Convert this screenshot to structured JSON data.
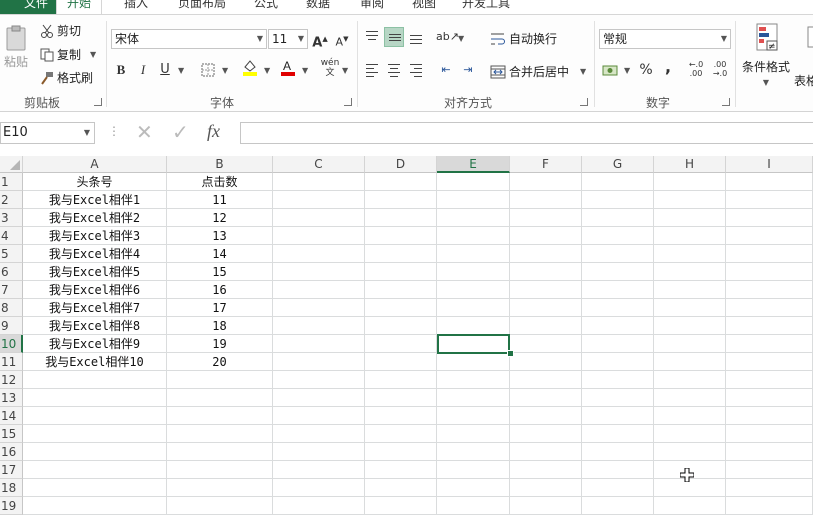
{
  "tabs": [
    {
      "label": "文件",
      "name": "tab-file"
    },
    {
      "label": "开始",
      "name": "tab-home"
    },
    {
      "label": "插入",
      "name": "tab-insert"
    },
    {
      "label": "页面布局",
      "name": "tab-page-layout"
    },
    {
      "label": "公式",
      "name": "tab-formulas"
    },
    {
      "label": "数据",
      "name": "tab-data"
    },
    {
      "label": "审阅",
      "name": "tab-review"
    },
    {
      "label": "视图",
      "name": "tab-view"
    },
    {
      "label": "开发工具",
      "name": "tab-developer"
    }
  ],
  "active_tab": "开始",
  "clipboard": {
    "paste": "粘贴",
    "cut": "剪切",
    "copy": "复制",
    "format_painter": "格式刷",
    "group": "剪贴板"
  },
  "font": {
    "name": "宋体",
    "size": "11",
    "bold": "B",
    "italic": "I",
    "underline": "U",
    "group": "字体"
  },
  "alignment": {
    "wrap_text": "自动换行",
    "merge_center": "合并后居中",
    "group": "对齐方式"
  },
  "number": {
    "format": "常规",
    "percent": "%",
    "comma": ",",
    "group": "数字"
  },
  "styles": {
    "conditional_format": "条件格式",
    "table_format_partial": "表格"
  },
  "formula_bar": {
    "name_box": "E10",
    "fx": "fx",
    "formula": ""
  },
  "columns": [
    "A",
    "B",
    "C",
    "D",
    "E",
    "F",
    "G",
    "H",
    "I"
  ],
  "active_column": "E",
  "active_row": 10,
  "rows": [
    [
      "头条号",
      "点击数"
    ],
    [
      "我与Excel相伴1",
      "11"
    ],
    [
      "我与Excel相伴2",
      "12"
    ],
    [
      "我与Excel相伴3",
      "13"
    ],
    [
      "我与Excel相伴4",
      "14"
    ],
    [
      "我与Excel相伴5",
      "15"
    ],
    [
      "我与Excel相伴6",
      "16"
    ],
    [
      "我与Excel相伴7",
      "17"
    ],
    [
      "我与Excel相伴8",
      "18"
    ],
    [
      "我与Excel相伴9",
      "19"
    ],
    [
      "我与Excel相伴10",
      "20"
    ]
  ],
  "row_count": 19,
  "colors": {
    "accent": "#217346",
    "font_color": "#e00000",
    "highlight": "#ffff00"
  }
}
